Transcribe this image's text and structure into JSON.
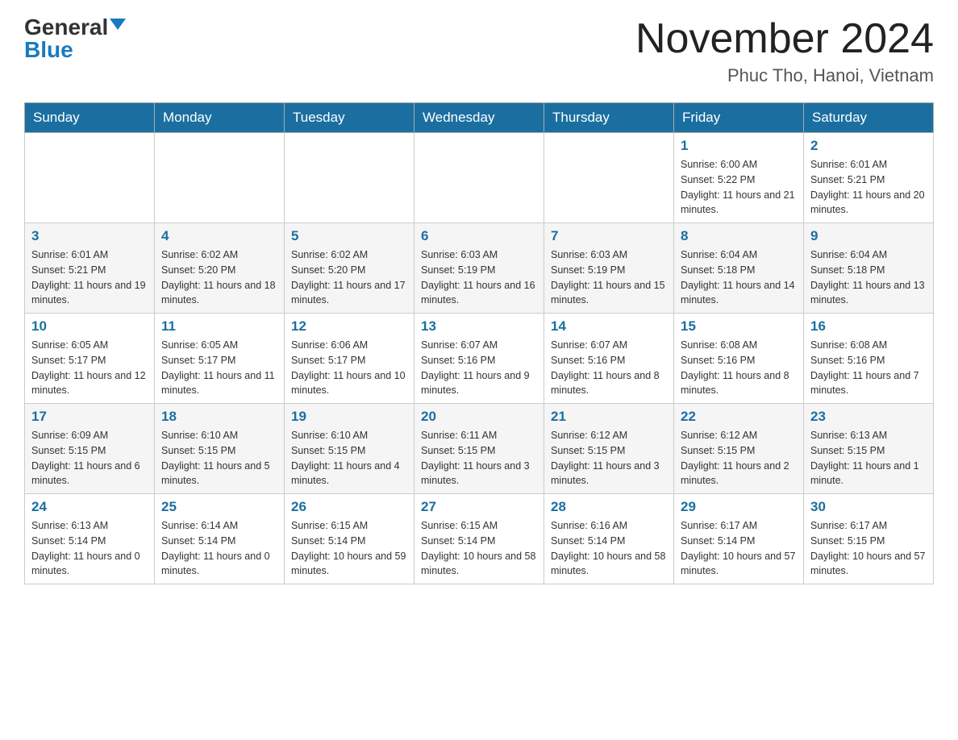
{
  "header": {
    "logo_general": "General",
    "logo_blue": "Blue",
    "month_year": "November 2024",
    "location": "Phuc Tho, Hanoi, Vietnam"
  },
  "weekdays": [
    "Sunday",
    "Monday",
    "Tuesday",
    "Wednesday",
    "Thursday",
    "Friday",
    "Saturday"
  ],
  "weeks": [
    [
      {
        "day": "",
        "info": ""
      },
      {
        "day": "",
        "info": ""
      },
      {
        "day": "",
        "info": ""
      },
      {
        "day": "",
        "info": ""
      },
      {
        "day": "",
        "info": ""
      },
      {
        "day": "1",
        "info": "Sunrise: 6:00 AM\nSunset: 5:22 PM\nDaylight: 11 hours and 21 minutes."
      },
      {
        "day": "2",
        "info": "Sunrise: 6:01 AM\nSunset: 5:21 PM\nDaylight: 11 hours and 20 minutes."
      }
    ],
    [
      {
        "day": "3",
        "info": "Sunrise: 6:01 AM\nSunset: 5:21 PM\nDaylight: 11 hours and 19 minutes."
      },
      {
        "day": "4",
        "info": "Sunrise: 6:02 AM\nSunset: 5:20 PM\nDaylight: 11 hours and 18 minutes."
      },
      {
        "day": "5",
        "info": "Sunrise: 6:02 AM\nSunset: 5:20 PM\nDaylight: 11 hours and 17 minutes."
      },
      {
        "day": "6",
        "info": "Sunrise: 6:03 AM\nSunset: 5:19 PM\nDaylight: 11 hours and 16 minutes."
      },
      {
        "day": "7",
        "info": "Sunrise: 6:03 AM\nSunset: 5:19 PM\nDaylight: 11 hours and 15 minutes."
      },
      {
        "day": "8",
        "info": "Sunrise: 6:04 AM\nSunset: 5:18 PM\nDaylight: 11 hours and 14 minutes."
      },
      {
        "day": "9",
        "info": "Sunrise: 6:04 AM\nSunset: 5:18 PM\nDaylight: 11 hours and 13 minutes."
      }
    ],
    [
      {
        "day": "10",
        "info": "Sunrise: 6:05 AM\nSunset: 5:17 PM\nDaylight: 11 hours and 12 minutes."
      },
      {
        "day": "11",
        "info": "Sunrise: 6:05 AM\nSunset: 5:17 PM\nDaylight: 11 hours and 11 minutes."
      },
      {
        "day": "12",
        "info": "Sunrise: 6:06 AM\nSunset: 5:17 PM\nDaylight: 11 hours and 10 minutes."
      },
      {
        "day": "13",
        "info": "Sunrise: 6:07 AM\nSunset: 5:16 PM\nDaylight: 11 hours and 9 minutes."
      },
      {
        "day": "14",
        "info": "Sunrise: 6:07 AM\nSunset: 5:16 PM\nDaylight: 11 hours and 8 minutes."
      },
      {
        "day": "15",
        "info": "Sunrise: 6:08 AM\nSunset: 5:16 PM\nDaylight: 11 hours and 8 minutes."
      },
      {
        "day": "16",
        "info": "Sunrise: 6:08 AM\nSunset: 5:16 PM\nDaylight: 11 hours and 7 minutes."
      }
    ],
    [
      {
        "day": "17",
        "info": "Sunrise: 6:09 AM\nSunset: 5:15 PM\nDaylight: 11 hours and 6 minutes."
      },
      {
        "day": "18",
        "info": "Sunrise: 6:10 AM\nSunset: 5:15 PM\nDaylight: 11 hours and 5 minutes."
      },
      {
        "day": "19",
        "info": "Sunrise: 6:10 AM\nSunset: 5:15 PM\nDaylight: 11 hours and 4 minutes."
      },
      {
        "day": "20",
        "info": "Sunrise: 6:11 AM\nSunset: 5:15 PM\nDaylight: 11 hours and 3 minutes."
      },
      {
        "day": "21",
        "info": "Sunrise: 6:12 AM\nSunset: 5:15 PM\nDaylight: 11 hours and 3 minutes."
      },
      {
        "day": "22",
        "info": "Sunrise: 6:12 AM\nSunset: 5:15 PM\nDaylight: 11 hours and 2 minutes."
      },
      {
        "day": "23",
        "info": "Sunrise: 6:13 AM\nSunset: 5:15 PM\nDaylight: 11 hours and 1 minute."
      }
    ],
    [
      {
        "day": "24",
        "info": "Sunrise: 6:13 AM\nSunset: 5:14 PM\nDaylight: 11 hours and 0 minutes."
      },
      {
        "day": "25",
        "info": "Sunrise: 6:14 AM\nSunset: 5:14 PM\nDaylight: 11 hours and 0 minutes."
      },
      {
        "day": "26",
        "info": "Sunrise: 6:15 AM\nSunset: 5:14 PM\nDaylight: 10 hours and 59 minutes."
      },
      {
        "day": "27",
        "info": "Sunrise: 6:15 AM\nSunset: 5:14 PM\nDaylight: 10 hours and 58 minutes."
      },
      {
        "day": "28",
        "info": "Sunrise: 6:16 AM\nSunset: 5:14 PM\nDaylight: 10 hours and 58 minutes."
      },
      {
        "day": "29",
        "info": "Sunrise: 6:17 AM\nSunset: 5:14 PM\nDaylight: 10 hours and 57 minutes."
      },
      {
        "day": "30",
        "info": "Sunrise: 6:17 AM\nSunset: 5:15 PM\nDaylight: 10 hours and 57 minutes."
      }
    ]
  ]
}
